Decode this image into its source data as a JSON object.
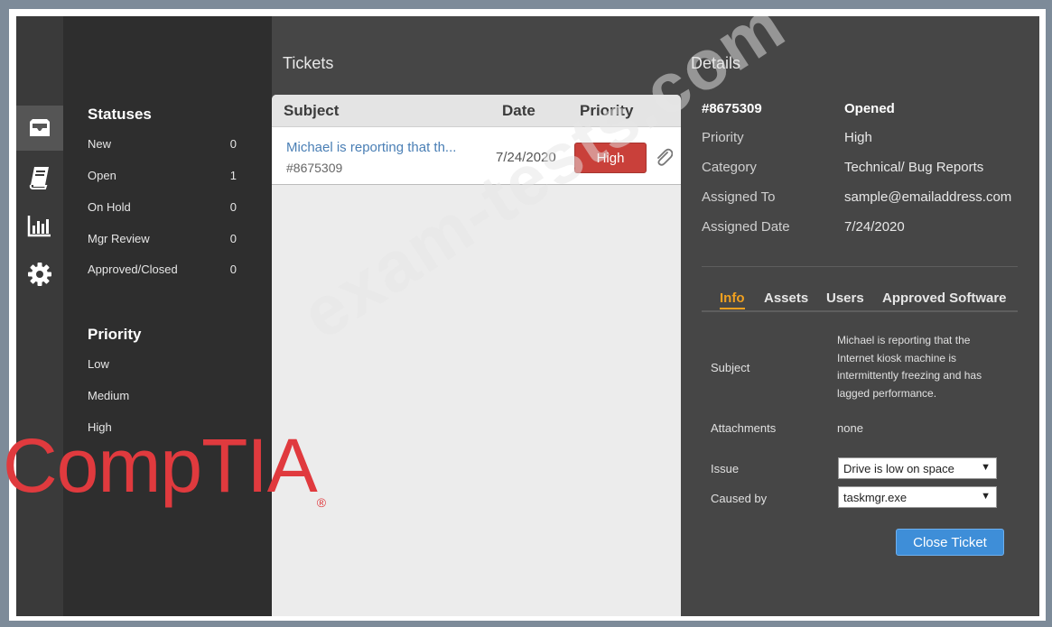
{
  "filters": {
    "statuses_title": "Statuses",
    "statuses": [
      {
        "label": "New",
        "count": "0"
      },
      {
        "label": "Open",
        "count": "1"
      },
      {
        "label": "On Hold",
        "count": "0"
      },
      {
        "label": "Mgr Review",
        "count": "0"
      },
      {
        "label": "Approved/Closed",
        "count": "0"
      }
    ],
    "priority_title": "Priority",
    "priorities": [
      "Low",
      "Medium",
      "High"
    ]
  },
  "tickets": {
    "heading": "Tickets",
    "columns": {
      "subject": "Subject",
      "date": "Date",
      "priority": "Priority"
    },
    "rows": [
      {
        "subject": "Michael is reporting that th...",
        "id": "#8675309",
        "date": "7/24/2020",
        "priority": "High"
      }
    ]
  },
  "details": {
    "heading": "Details",
    "ticket_id": "#8675309",
    "status": "Opened",
    "fields": [
      {
        "label": "Priority",
        "value": "High"
      },
      {
        "label": "Category",
        "value": "Technical/ Bug Reports"
      },
      {
        "label": "Assigned To",
        "value": "sample@emailaddress.com"
      },
      {
        "label": "Assigned Date",
        "value": "7/24/2020"
      }
    ],
    "tabs": [
      "Info",
      "Assets",
      "Users",
      "Approved Software"
    ],
    "info": {
      "subject_label": "Subject",
      "subject_text": "Michael is reporting that the Internet kiosk machine is intermittently freezing and has lagged performance.",
      "attachments_label": "Attachments",
      "attachments_value": "none",
      "issue_label": "Issue",
      "issue_value": "Drive is low on space",
      "caused_by_label": "Caused by",
      "caused_by_value": "taskmgr.exe"
    },
    "close_button": "Close Ticket"
  },
  "watermarks": {
    "logo": "CompTIA",
    "registered": "®",
    "site": "exam-tests.com"
  },
  "colors": {
    "priority_high": "#c9403a",
    "accent_tab": "#f0a020",
    "primary_button": "#3e8ed8",
    "link": "#4a7fb5",
    "logo": "#e03a3e"
  }
}
